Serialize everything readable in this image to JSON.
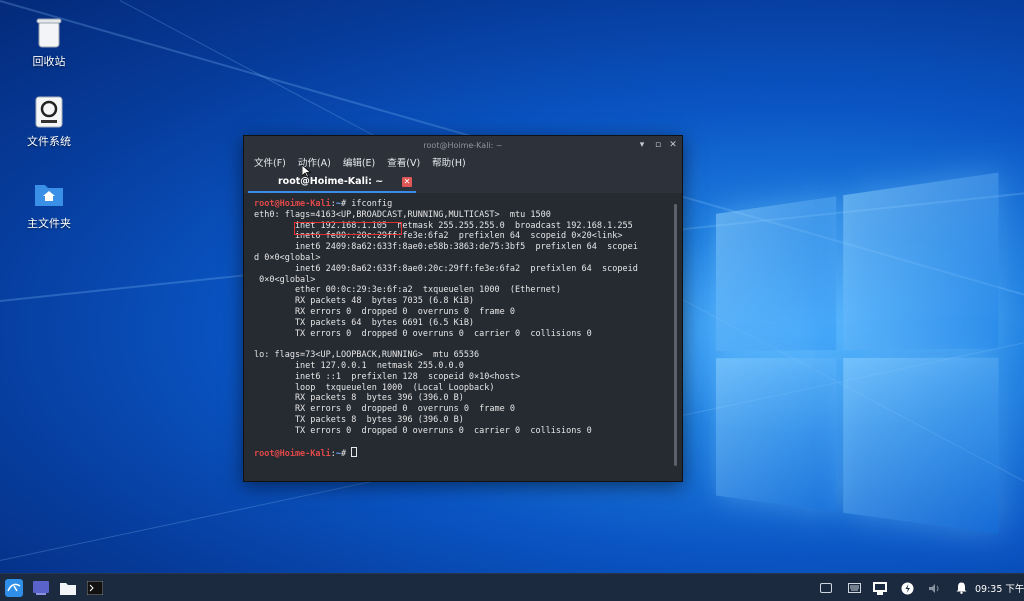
{
  "desktop": {
    "icons": [
      {
        "label": "回收站",
        "icon": "trash-icon"
      },
      {
        "label": "文件系统",
        "icon": "drive-icon"
      },
      {
        "label": "主文件夹",
        "icon": "home-folder-icon"
      }
    ]
  },
  "terminal": {
    "window_title": "root@Hoime-Kali: ~",
    "menu": [
      "文件(F)",
      "动作(A)",
      "编辑(E)",
      "查看(V)",
      "帮助(H)"
    ],
    "tab_label": "root@Hoime-Kali: ~",
    "prompt_user": "root@Hoime-Kali",
    "prompt_sep": ":",
    "prompt_dir": "~",
    "prompt_sym": "# ",
    "command": "ifconfig",
    "output_lines": [
      "eth0: flags=4163<UP,BROADCAST,RUNNING,MULTICAST>  mtu 1500",
      "        inet 192.168.1.105  netmask 255.255.255.0  broadcast 192.168.1.255",
      "        inet6 fe80::20c:29ff:fe3e:6fa2  prefixlen 64  scopeid 0×20<link>",
      "        inet6 2409:8a62:633f:8ae0:e58b:3863:de75:3bf5  prefixlen 64  scopei",
      "d 0×0<global>",
      "        inet6 2409:8a62:633f:8ae0:20c:29ff:fe3e:6fa2  prefixlen 64  scopeid",
      " 0×0<global>",
      "        ether 00:0c:29:3e:6f:a2  txqueuelen 1000  (Ethernet)",
      "        RX packets 48  bytes 7035 (6.8 KiB)",
      "        RX errors 0  dropped 0  overruns 0  frame 0",
      "        TX packets 64  bytes 6691 (6.5 KiB)",
      "        TX errors 0  dropped 0 overruns 0  carrier 0  collisions 0",
      "",
      "lo: flags=73<UP,LOOPBACK,RUNNING>  mtu 65536",
      "        inet 127.0.0.1  netmask 255.0.0.0",
      "        inet6 ::1  prefixlen 128  scopeid 0×10<host>",
      "        loop  txqueuelen 1000  (Local Loopback)",
      "        RX packets 8  bytes 396 (396.0 B)",
      "        RX errors 0  dropped 0  overruns 0  frame 0",
      "        TX packets 8  bytes 396 (396.0 B)",
      "        TX errors 0  dropped 0 overruns 0  carrier 0  collisions 0",
      ""
    ]
  },
  "taskbar": {
    "launchers": [
      "kali-menu-icon",
      "desktop-icon",
      "file-manager-icon",
      "terminal-icon"
    ],
    "tray": [
      "screen-icon",
      "keyboard-icon",
      "network-icon",
      "power-icon",
      "volume-icon",
      "notification-icon"
    ],
    "clock": "09:35 下午"
  },
  "colors": {
    "accent": "#3d8be8",
    "prompt_user": "#e04848",
    "prompt_dir": "#6aa6ff",
    "highlight_box": "#e03030"
  }
}
